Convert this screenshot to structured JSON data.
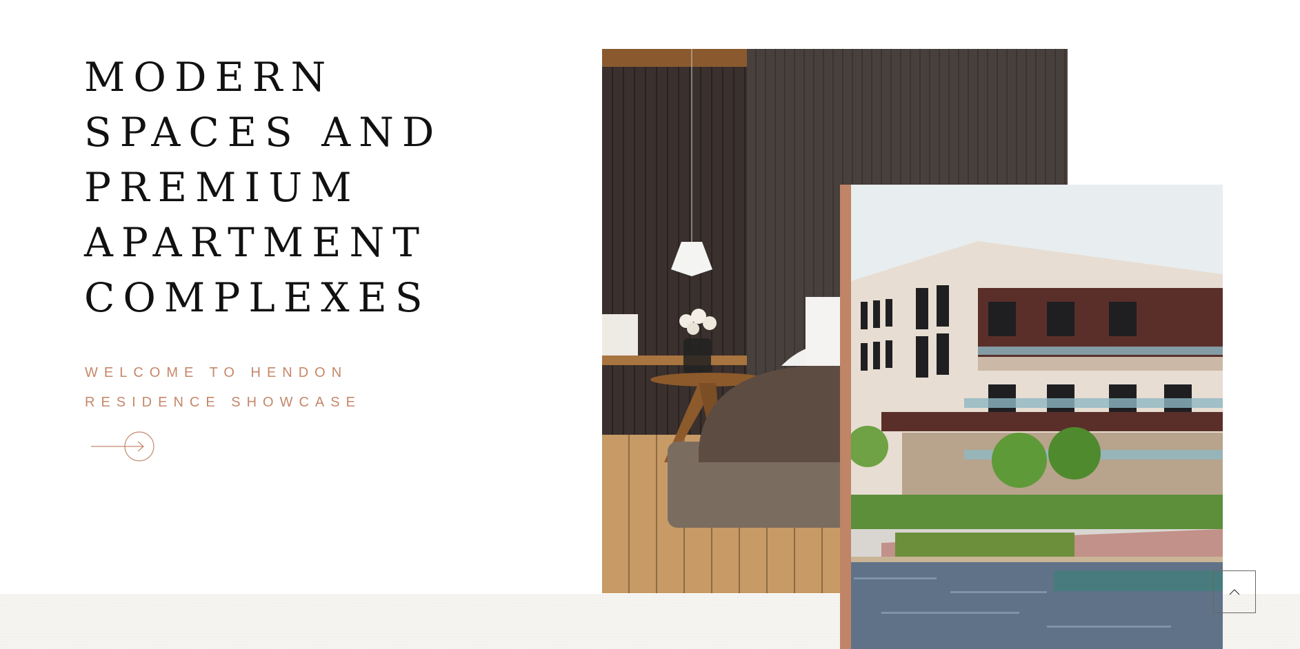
{
  "hero": {
    "title_lines": [
      "MODERN",
      "SPACES AND",
      "PREMIUM",
      "APARTMENT",
      "COMPLEXES"
    ],
    "subtitle_lines": [
      "WELCOME TO HENDON",
      "RESIDENCE SHOWCASE"
    ]
  },
  "icons": {
    "arrow": "arrow-right-circle-icon",
    "scroll_top": "chevron-up-icon"
  },
  "colors": {
    "accent": "#c4876a",
    "title": "#111111",
    "band": "#f6f4f1"
  }
}
